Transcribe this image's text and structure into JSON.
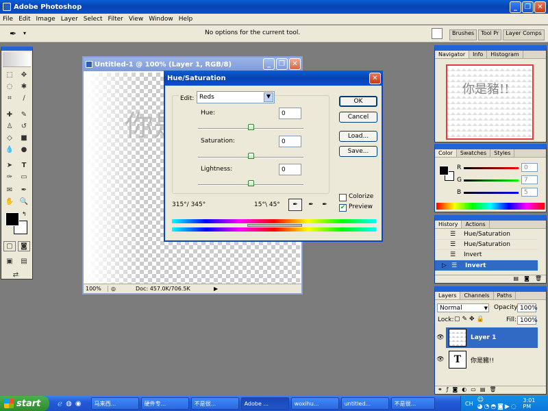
{
  "app": {
    "title": "Adobe Photoshop"
  },
  "menu": [
    "File",
    "Edit",
    "Image",
    "Layer",
    "Select",
    "Filter",
    "View",
    "Window",
    "Help"
  ],
  "options_bar": {
    "message": "No options for the current tool.",
    "dock_tabs": [
      "Brushes",
      "Tool Pr",
      "Layer Comps"
    ]
  },
  "document": {
    "title": "Untitled-1 @ 100% (Layer 1, RGB/8)",
    "canvas_text": "你是豬!!",
    "zoom": "100%",
    "doc_info": "Doc: 457.0K/706.5K"
  },
  "dialog": {
    "title": "Hue/Saturation",
    "edit_label": "Edit:",
    "edit_value": "Reds",
    "hue_label": "Hue:",
    "hue_value": "0",
    "saturation_label": "Saturation:",
    "saturation_value": "0",
    "lightness_label": "Lightness:",
    "lightness_value": "0",
    "range_left": "315°/ 345°",
    "range_right": "15°\\ 45°",
    "ok": "OK",
    "cancel": "Cancel",
    "load": "Load...",
    "save": "Save...",
    "colorize_label": "Colorize",
    "colorize_checked": false,
    "preview_label": "Preview",
    "preview_checked": true
  },
  "navigator": {
    "tabs": [
      "Navigator",
      "Info",
      "Histogram"
    ],
    "preview_text": "你是豬!!"
  },
  "color": {
    "tabs": [
      "Color",
      "Swatches",
      "Styles"
    ],
    "r_label": "R",
    "g_label": "G",
    "b_label": "B",
    "r": "0",
    "g": "7",
    "b": "5"
  },
  "history": {
    "tabs": [
      "History",
      "Actions"
    ],
    "items": [
      "Hue/Saturation",
      "Hue/Saturation",
      "Invert",
      "Invert"
    ]
  },
  "layers": {
    "tabs": [
      "Layers",
      "Channels",
      "Paths"
    ],
    "blend_mode": "Normal",
    "opacity_label": "Opacity:",
    "opacity": "100%",
    "lock_label": "Lock:",
    "fill_label": "Fill:",
    "fill": "100%",
    "items": [
      "Layer 1",
      "你是豬!!"
    ]
  },
  "taskbar": {
    "start": "start",
    "tasks": [
      "马来西...",
      "硬件专...",
      "不是很...",
      "Adobe ...",
      "woxihu...",
      "untitled...",
      "不是很..."
    ],
    "clock": "3:01 PM",
    "lang": "CH"
  },
  "colors": {
    "xp_blue": "#0a5fd8",
    "panel_bg": "#ece9d8",
    "selection": "#316ac5"
  }
}
